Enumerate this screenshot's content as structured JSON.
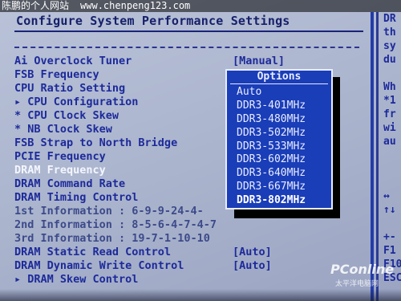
{
  "watermark": {
    "site": "陈鹏的个人网站",
    "url": "www.chenpeng123.com"
  },
  "title": "Configure System Performance Settings",
  "menu": [
    {
      "label": "Ai Overclock Tuner",
      "value": "[Manual]",
      "type": "setting"
    },
    {
      "label": "FSB Frequency",
      "value": "",
      "type": "setting"
    },
    {
      "label": "CPU Ratio Setting",
      "value": "",
      "type": "setting"
    },
    {
      "label": "▸ CPU Configuration",
      "value": "",
      "type": "submenu"
    },
    {
      "label": "* CPU Clock Skew",
      "value": "",
      "type": "setting"
    },
    {
      "label": "* NB Clock Skew",
      "value": "",
      "type": "setting"
    },
    {
      "label": "FSB Strap to North Bridge",
      "value": "",
      "type": "setting"
    },
    {
      "label": "PCIE Frequency",
      "value": "",
      "type": "setting"
    },
    {
      "label": "DRAM Frequency",
      "value": "",
      "type": "setting",
      "selected": true
    },
    {
      "label": "DRAM Command Rate",
      "value": "",
      "type": "setting"
    },
    {
      "label": "DRAM Timing Control",
      "value": "",
      "type": "setting"
    },
    {
      "label": " 1st Information : 6-9-9-24-4-",
      "value": "",
      "type": "info"
    },
    {
      "label": " 2nd Information : 8-5-6-4-7-4-7",
      "value": "",
      "type": "info"
    },
    {
      "label": " 3rd Information : 19-7-1-10-10",
      "value": "",
      "type": "info"
    },
    {
      "label": "DRAM Static Read Control",
      "value": "[Auto]",
      "type": "setting"
    },
    {
      "label": "DRAM Dynamic Write Control",
      "value": "[Auto]",
      "type": "setting"
    },
    {
      "label": "▸ DRAM Skew Control",
      "value": "",
      "type": "submenu"
    }
  ],
  "popup": {
    "title": "Options",
    "options": [
      "Auto",
      "DDR3-401MHz",
      "DDR3-480MHz",
      "DDR3-502MHz",
      "DDR3-533MHz",
      "DDR3-602MHz",
      "DDR3-640MHz",
      "DDR3-667MHz",
      "DDR3-802MHz"
    ],
    "selected": "DDR3-802MHz"
  },
  "help_panel": [
    "DR",
    "th",
    "sy",
    "du",
    "",
    "Wh",
    "*1",
    "fr",
    "wi",
    "au",
    "",
    "",
    "",
    "↔",
    "↑↓",
    "",
    "+-",
    "F1",
    "F10",
    "ESC"
  ],
  "logo": {
    "name": "PConline",
    "sub": "太平洋电脑网"
  },
  "colors": {
    "background": "#b9c2d8",
    "text": "#1d2a9a",
    "popup_bg": "#1a3db8",
    "selected_text": "#f4f6ff"
  }
}
